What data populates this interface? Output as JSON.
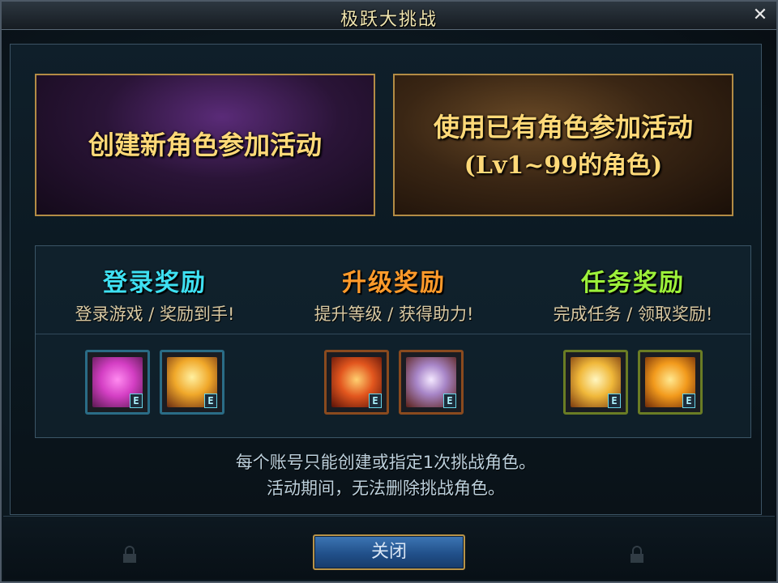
{
  "window": {
    "title": "极跃大挑战"
  },
  "choices": {
    "new": {
      "label": "创建新角色参加活动"
    },
    "existing": {
      "label": "使用已有角色参加活动",
      "sub": "(Lv1~99的角色)"
    }
  },
  "rewards": [
    {
      "title": "登录奖励",
      "sub": "登录游戏 / 奖励到手!",
      "color": "#3ee0f2",
      "items": [
        {
          "icon": "pink-gift-box-icon",
          "tag": "E"
        },
        {
          "icon": "golden-chest-icon",
          "tag": "E"
        }
      ]
    },
    {
      "title": "升级奖励",
      "sub": "提升等级 / 获得助力!",
      "color": "#ff9a2a",
      "items": [
        {
          "icon": "red-sword-shield-icon",
          "tag": "E"
        },
        {
          "icon": "white-armor-box-icon",
          "tag": "E"
        }
      ]
    },
    {
      "title": "任务奖励",
      "sub": "完成任务 / 领取奖励!",
      "color": "#9cf03a",
      "items": [
        {
          "icon": "gold-trophy-icon",
          "tag": "E"
        },
        {
          "icon": "gold-treasure-icon",
          "tag": "E"
        }
      ]
    }
  ],
  "notice": {
    "line1": "每个账号只能创建或指定1次挑战角色。",
    "line2": "活动期间，无法删除挑战角色。"
  },
  "footer": {
    "close_label": "关闭"
  },
  "colors": {
    "accent_gold": "#ffd978",
    "frame_gold": "#b38c45"
  }
}
